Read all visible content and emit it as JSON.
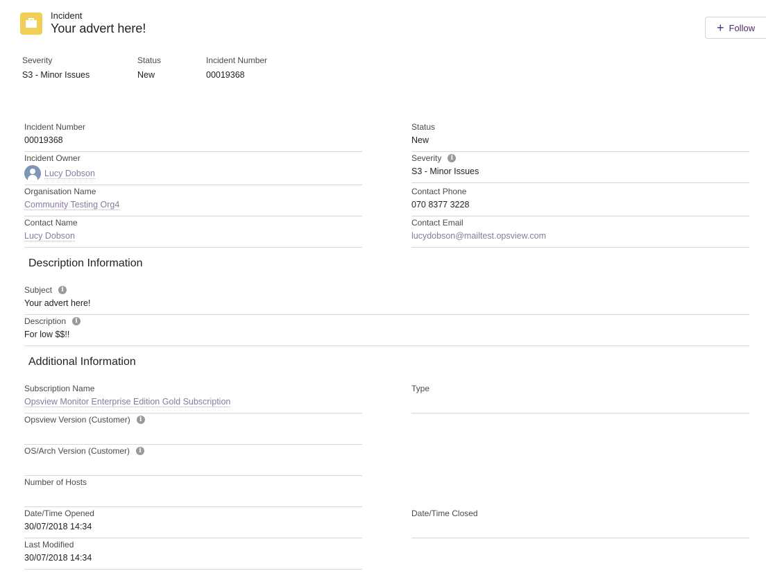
{
  "header": {
    "object_label": "Incident",
    "title": "Your advert here!",
    "follow_label": "Follow",
    "follow_icon": "plus-icon",
    "record_icon": "briefcase-icon",
    "record_icon_color": "#f1ce55"
  },
  "highlights": [
    {
      "label": "Severity",
      "value": "S3 - Minor Issues"
    },
    {
      "label": "Status",
      "value": "New"
    },
    {
      "label": "Incident Number",
      "value": "00019368"
    }
  ],
  "details": {
    "incident_number": {
      "label": "Incident Number",
      "value": "00019368"
    },
    "status": {
      "label": "Status",
      "value": "New"
    },
    "incident_owner": {
      "label": "Incident Owner",
      "value": "Lucy Dobson"
    },
    "severity": {
      "label": "Severity",
      "value": "S3 - Minor Issues"
    },
    "organisation_name": {
      "label": "Organisation Name",
      "value": "Community Testing Org4"
    },
    "contact_phone": {
      "label": "Contact Phone",
      "value": "070 8377 3228"
    },
    "contact_name": {
      "label": "Contact Name",
      "value": "Lucy Dobson"
    },
    "contact_email": {
      "label": "Contact Email",
      "value": "lucydobson@mailtest.opsview.com"
    }
  },
  "description_section": {
    "title": "Description Information",
    "subject": {
      "label": "Subject",
      "value": "Your advert here!"
    },
    "description": {
      "label": "Description",
      "value": "For low $$!!"
    }
  },
  "additional_section": {
    "title": "Additional Information",
    "subscription_name": {
      "label": "Subscription Name",
      "value": "Opsview Monitor Enterprise Edition Gold Subscription"
    },
    "type": {
      "label": "Type",
      "value": ""
    },
    "opsview_version": {
      "label": "Opsview Version (Customer)",
      "value": ""
    },
    "os_arch_version": {
      "label": "OS/Arch Version (Customer)",
      "value": ""
    },
    "number_of_hosts": {
      "label": "Number of Hosts",
      "value": ""
    },
    "date_time_opened": {
      "label": "Date/Time Opened",
      "value": "30/07/2018 14:34"
    },
    "date_time_closed": {
      "label": "Date/Time Closed",
      "value": ""
    },
    "last_modified": {
      "label": "Last Modified",
      "value": "30/07/2018 14:34"
    }
  },
  "colors": {
    "link": "#8a7aa0",
    "brand_accent": "#4b2a72",
    "divider": "#d8d8d8"
  }
}
